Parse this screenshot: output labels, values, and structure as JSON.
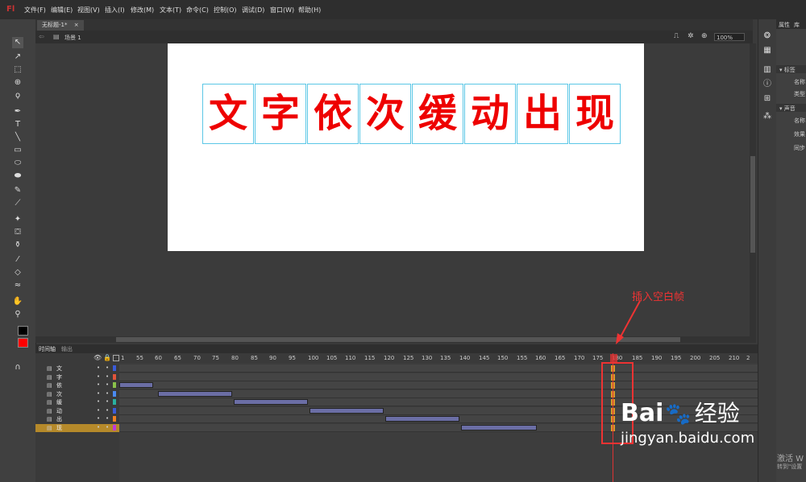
{
  "app": {
    "logo": "Fl"
  },
  "menu": [
    "文件(F)",
    "编辑(E)",
    "视图(V)",
    "插入(I)",
    "修改(M)",
    "文本(T)",
    "命令(C)",
    "控制(O)",
    "调试(D)",
    "窗口(W)",
    "帮助(H)"
  ],
  "document_tab": {
    "title": "无标题-1*",
    "close": "×"
  },
  "scene": {
    "label": "场景 1",
    "zoom": "100%"
  },
  "stage_chars": [
    "文",
    "字",
    "依",
    "次",
    "缓",
    "动",
    "出",
    "现"
  ],
  "right_panel": {
    "tab1": "属性",
    "tab2": "库",
    "section_label": "标签",
    "name": "名称",
    "type": "类型",
    "section_sound": "声音",
    "name2": "名称",
    "effect": "效果",
    "sync": "同步"
  },
  "timeline": {
    "tab1": "时间轴",
    "tab2": "输出",
    "ticks": [
      "1",
      "55",
      "60",
      "65",
      "70",
      "75",
      "80",
      "85",
      "90",
      "95",
      "100",
      "105",
      "110",
      "115",
      "120",
      "125",
      "130",
      "135",
      "140",
      "145",
      "150",
      "155",
      "160",
      "165",
      "170",
      "175",
      "180",
      "185",
      "190",
      "195",
      "200",
      "205",
      "210",
      "2"
    ],
    "layers": [
      {
        "name": "文",
        "color": "#3a5bd9"
      },
      {
        "name": "字",
        "color": "#e0543b"
      },
      {
        "name": "依",
        "color": "#8ac24a"
      },
      {
        "name": "次",
        "color": "#4a8af0"
      },
      {
        "name": "缓",
        "color": "#2ab0a0"
      },
      {
        "name": "动",
        "color": "#3a5bd9"
      },
      {
        "name": "出",
        "color": "#f08020"
      },
      {
        "name": "现",
        "color": "#c03ad9"
      }
    ],
    "active_layer": "现"
  },
  "annotation": "插入空白帧",
  "watermark": {
    "brand": "Bai",
    "brand2": "经验",
    "url": "jingyan.baidu.com"
  },
  "activate": {
    "line1": "激活 W",
    "line2": "转到\"设置"
  }
}
